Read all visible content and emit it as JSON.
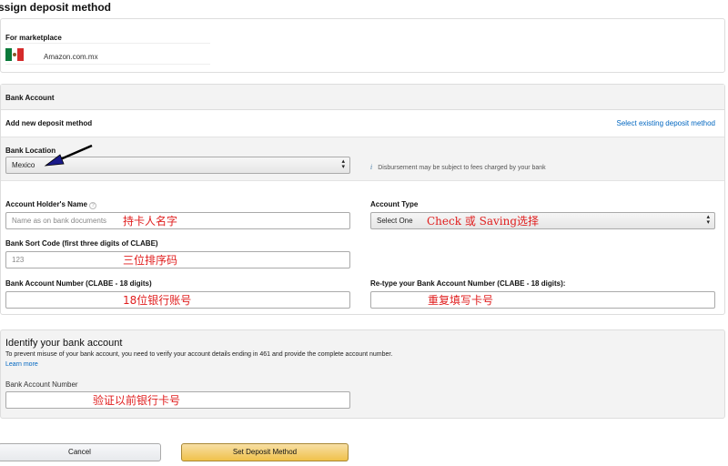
{
  "page_title": "ssign deposit method",
  "marketplace": {
    "label": "For marketplace",
    "name": "Amazon.com.mx",
    "flag_icon": "mexico-flag-icon"
  },
  "bank_account": {
    "header": "Bank Account",
    "add_new": "Add new deposit method",
    "select_existing": "Select existing deposit method",
    "location_label": "Bank Location",
    "location_value": "Mexico",
    "info_text": "Disbursement may be subject to fees charged by your bank",
    "holder_label": "Account Holder's Name",
    "holder_placeholder": "Name as on bank documents",
    "holder_note": "持卡人名字",
    "type_label": "Account Type",
    "type_value": "Select One",
    "type_note": "Check 或 Saving选择",
    "sort_label": "Bank Sort Code (first three digits of CLABE)",
    "sort_placeholder": "123",
    "sort_note": "三位排序码",
    "number_label": "Bank Account Number (CLABE - 18 digits)",
    "number_note": "18位银行账号",
    "retype_label": "Re-type your Bank Account Number (CLABE - 18 digits):",
    "retype_note": "重复填写卡号"
  },
  "identify": {
    "title": "Identify your bank account",
    "description": "To prevent misuse of your bank account, you need to verify your account details ending in 461 and provide the complete account number.",
    "learn_more": "Learn more",
    "number_label": "Bank Account Number",
    "number_note": "验证以前银行卡号"
  },
  "buttons": {
    "cancel": "Cancel",
    "submit": "Set Deposit Method"
  },
  "colors": {
    "link": "#0066c0",
    "button_yellow": "#f0c14b",
    "annotation": "#e01e1e"
  }
}
